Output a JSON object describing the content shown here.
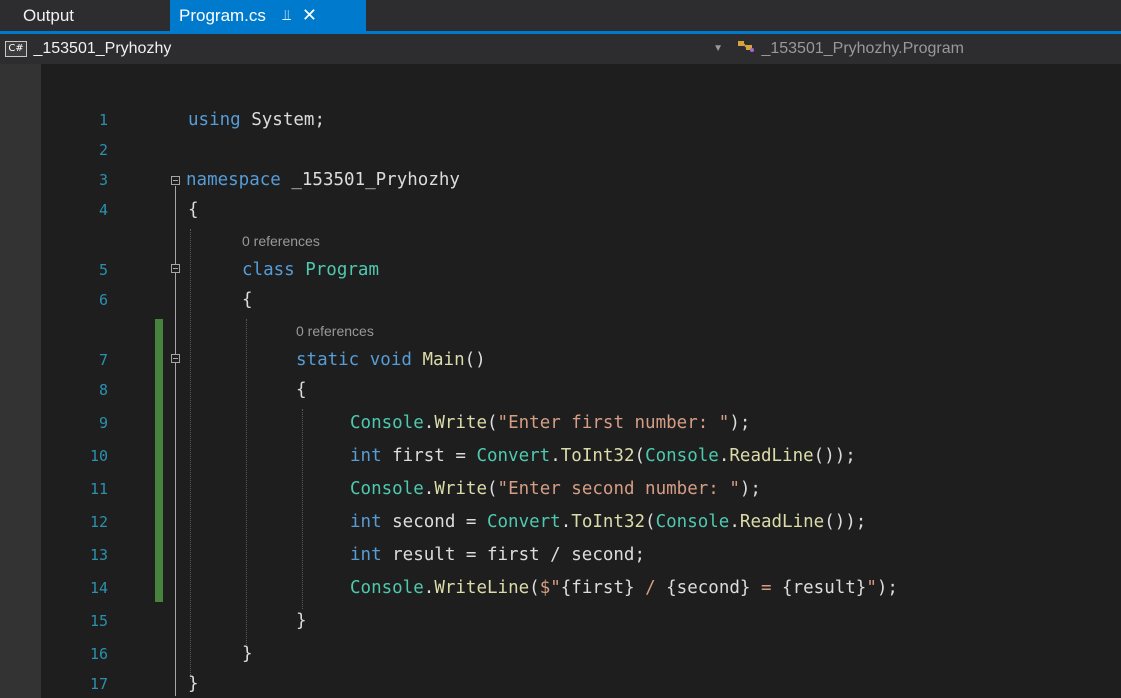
{
  "tabs": {
    "output_label": "Output",
    "program_label": "Program.cs",
    "pin_icon": "⫫",
    "close_icon": "✕"
  },
  "navbar": {
    "project_icon_text": "C#",
    "project_name": "_153501_Pryhozhy",
    "dropdown_icon": "▼",
    "class_icon": "✨",
    "class_name": "_153501_Pryhozhy.Program"
  },
  "editor": {
    "codelens_text": "0 references",
    "line_numbers": [
      "1",
      "2",
      "3",
      "4",
      "5",
      "6",
      "7",
      "8",
      "9",
      "10",
      "11",
      "12",
      "13",
      "14",
      "15",
      "16",
      "17"
    ],
    "lines": {
      "l1_kw": "using",
      "l1_rest": " System;",
      "l3_kw": "namespace",
      "l3_rest": " _153501_Pryhozhy",
      "l4": "{",
      "l5_kw": "class",
      "l5_type": "Program",
      "l6": "{",
      "l7_kw1": "static",
      "l7_kw2": "void",
      "l7_method": "Main",
      "l7_rest": "()",
      "l8": "{",
      "l9_type": "Console",
      "l9_dot": ".",
      "l9_method": "Write",
      "l9_open": "(",
      "l9_str": "\"Enter first number: \"",
      "l9_close": ");",
      "l10_kw": "int",
      "l10_mid": " first = ",
      "l10_type1": "Convert",
      "l10_dot1": ".",
      "l10_method1": "ToInt32",
      "l10_open": "(",
      "l10_type2": "Console",
      "l10_dot2": ".",
      "l10_method2": "ReadLine",
      "l10_close": "());",
      "l11_type": "Console",
      "l11_dot": ".",
      "l11_method": "Write",
      "l11_open": "(",
      "l11_str": "\"Enter second number: \"",
      "l11_close": ");",
      "l12_kw": "int",
      "l12_mid": " second = ",
      "l12_type1": "Convert",
      "l12_dot1": ".",
      "l12_method1": "ToInt32",
      "l12_open": "(",
      "l12_type2": "Console",
      "l12_dot2": ".",
      "l12_method2": "ReadLine",
      "l12_close": "());",
      "l13_kw": "int",
      "l13_rest": " result = first / second;",
      "l14_type": "Console",
      "l14_dot": ".",
      "l14_method": "WriteLine",
      "l14_open": "(",
      "l14_str1": "$\"",
      "l14_interp1": "{first}",
      "l14_str2": " / ",
      "l14_interp2": "{second}",
      "l14_str3": " = ",
      "l14_interp3": "{result}",
      "l14_str4": "\"",
      "l14_close": ");",
      "l15": "}",
      "l16": "}",
      "l17": "}"
    }
  },
  "colors": {
    "accent": "#007acc",
    "keyword": "#569cd6",
    "type": "#4ec9b0",
    "method": "#dcdcaa",
    "string": "#d69d85",
    "line_number": "#2b91af",
    "change_marker": "#57a64a"
  }
}
